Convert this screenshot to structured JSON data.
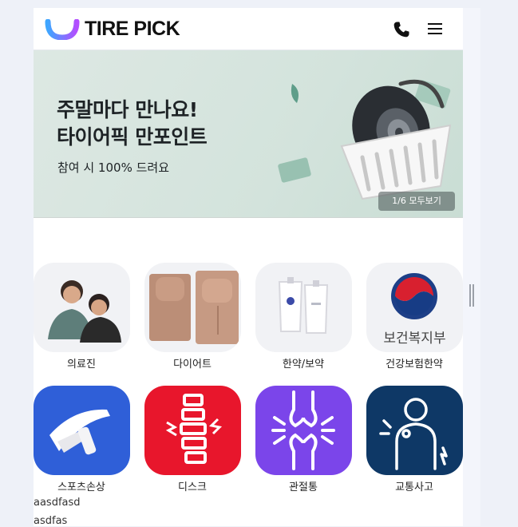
{
  "header": {
    "brand": "TIRE PICK",
    "brand_colors": {
      "gradient_start": "#3ea6ff",
      "gradient_end": "#b44dff"
    }
  },
  "banner": {
    "title_line1": "주말마다 만나요!",
    "title_line2": "타이어픽 만포인트",
    "subtitle": "참여 시 100% 드려요",
    "counter": "1/6 모두보기"
  },
  "categories_row1": [
    {
      "label": "의료진",
      "icon": "medical-staff-photo"
    },
    {
      "label": "다이어트",
      "icon": "diet-photo"
    },
    {
      "label": "한약/보약",
      "icon": "herbal-medicine-pouch"
    },
    {
      "label": "건강보험한약",
      "icon": "ministry-health-logo",
      "logo_text": "보건복지부"
    }
  ],
  "categories_row2": [
    {
      "label": "스포츠손상",
      "icon": "sports-injury-icon",
      "color": "#2f5fd8"
    },
    {
      "label": "디스크",
      "icon": "spine-disc-icon",
      "color": "#e8162c"
    },
    {
      "label": "관절통",
      "icon": "joint-pain-icon",
      "color": "#7b45ea"
    },
    {
      "label": "교통사고",
      "icon": "traffic-accident-icon",
      "color": "#0e3866"
    }
  ],
  "footer": {
    "line1": "aasdfasd",
    "line2": "asdfas"
  }
}
